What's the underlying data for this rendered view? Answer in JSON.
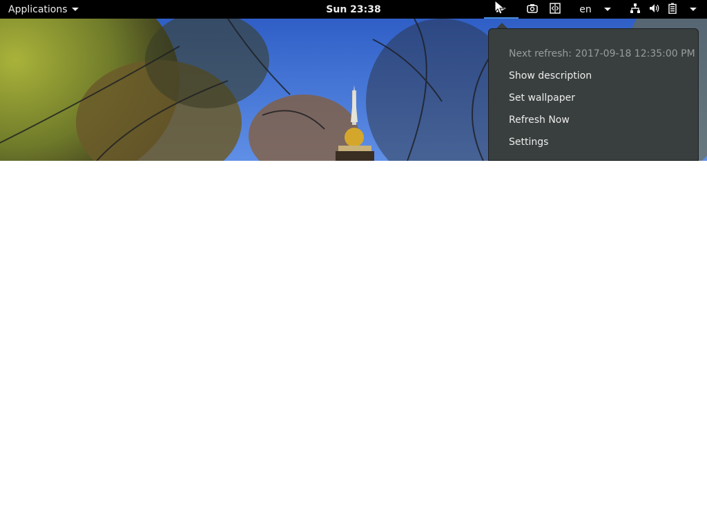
{
  "topbar": {
    "applications_label": "Applications",
    "clock": "Sun 23:38",
    "language": "en",
    "icons": {
      "wallpaper_extension": "bing-wallpaper-icon",
      "screenshot": "camera-icon",
      "code": "code-icon",
      "language_dropdown": "chevron-down-icon",
      "network": "network-wired-icon",
      "volume": "speaker-icon",
      "battery": "battery-icon",
      "system_menu": "chevron-down-icon"
    },
    "active_indicator_color": "#4a90d9"
  },
  "popup": {
    "next_refresh_label": "Next refresh:",
    "next_refresh_value": "2017-09-18 12:35:00 PM",
    "items": [
      {
        "label": "Show description"
      },
      {
        "label": "Set wallpaper"
      },
      {
        "label": "Refresh Now"
      },
      {
        "label": "Settings"
      }
    ],
    "background_color": "#393f3f"
  },
  "desktop": {
    "background_color": "#ffffff"
  }
}
